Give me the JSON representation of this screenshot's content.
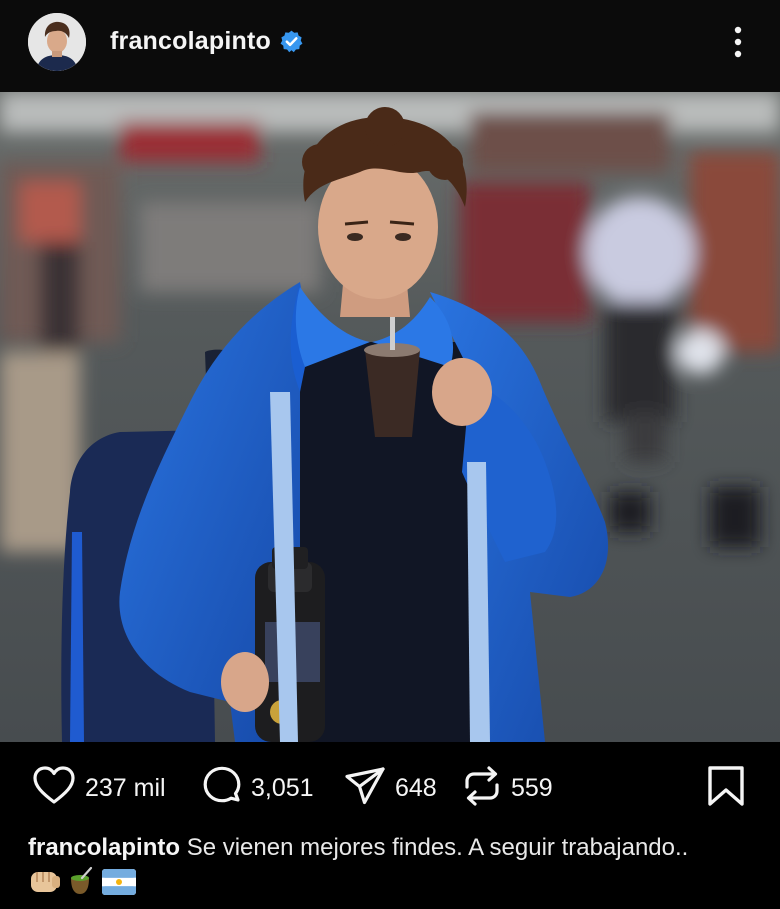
{
  "post": {
    "username": "francolapinto",
    "verified": true,
    "menu_icon": "more-vertical-icon",
    "image_alt": "Young driver in a blue team jacket sipping mate in the paddock, holding a thermos"
  },
  "actions": {
    "likes": "237 mil",
    "comments": "3,051",
    "shares": "648",
    "reposts": "559",
    "like_icon": "heart-icon",
    "comment_icon": "comment-icon",
    "share_icon": "send-icon",
    "repost_icon": "repost-icon",
    "save_icon": "bookmark-icon"
  },
  "caption": {
    "username": "francolapinto",
    "text": "Se vienen mejores findes. A seguir trabajando..",
    "emojis": [
      "fist-icon",
      "mate-icon",
      "argentina-flag-icon"
    ]
  },
  "colors": {
    "background": "#000000",
    "text": "#f5f5f5",
    "verified": "#3797f0",
    "jacket_blue": "#1b5fc9"
  }
}
